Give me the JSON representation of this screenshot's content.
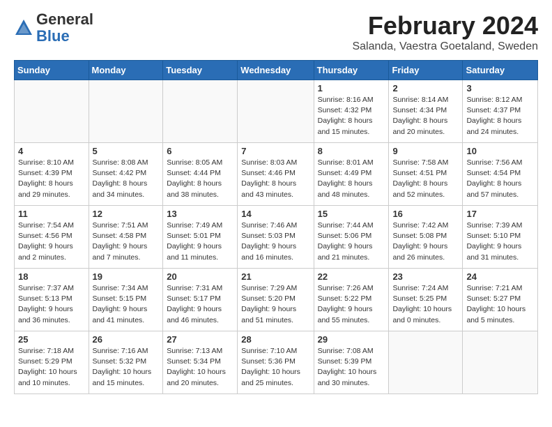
{
  "header": {
    "logo_general": "General",
    "logo_blue": "Blue",
    "month_title": "February 2024",
    "location": "Salanda, Vaestra Goetaland, Sweden"
  },
  "days_of_week": [
    "Sunday",
    "Monday",
    "Tuesday",
    "Wednesday",
    "Thursday",
    "Friday",
    "Saturday"
  ],
  "weeks": [
    [
      {
        "day": "",
        "info": ""
      },
      {
        "day": "",
        "info": ""
      },
      {
        "day": "",
        "info": ""
      },
      {
        "day": "",
        "info": ""
      },
      {
        "day": "1",
        "info": "Sunrise: 8:16 AM\nSunset: 4:32 PM\nDaylight: 8 hours\nand 15 minutes."
      },
      {
        "day": "2",
        "info": "Sunrise: 8:14 AM\nSunset: 4:34 PM\nDaylight: 8 hours\nand 20 minutes."
      },
      {
        "day": "3",
        "info": "Sunrise: 8:12 AM\nSunset: 4:37 PM\nDaylight: 8 hours\nand 24 minutes."
      }
    ],
    [
      {
        "day": "4",
        "info": "Sunrise: 8:10 AM\nSunset: 4:39 PM\nDaylight: 8 hours\nand 29 minutes."
      },
      {
        "day": "5",
        "info": "Sunrise: 8:08 AM\nSunset: 4:42 PM\nDaylight: 8 hours\nand 34 minutes."
      },
      {
        "day": "6",
        "info": "Sunrise: 8:05 AM\nSunset: 4:44 PM\nDaylight: 8 hours\nand 38 minutes."
      },
      {
        "day": "7",
        "info": "Sunrise: 8:03 AM\nSunset: 4:46 PM\nDaylight: 8 hours\nand 43 minutes."
      },
      {
        "day": "8",
        "info": "Sunrise: 8:01 AM\nSunset: 4:49 PM\nDaylight: 8 hours\nand 48 minutes."
      },
      {
        "day": "9",
        "info": "Sunrise: 7:58 AM\nSunset: 4:51 PM\nDaylight: 8 hours\nand 52 minutes."
      },
      {
        "day": "10",
        "info": "Sunrise: 7:56 AM\nSunset: 4:54 PM\nDaylight: 8 hours\nand 57 minutes."
      }
    ],
    [
      {
        "day": "11",
        "info": "Sunrise: 7:54 AM\nSunset: 4:56 PM\nDaylight: 9 hours\nand 2 minutes."
      },
      {
        "day": "12",
        "info": "Sunrise: 7:51 AM\nSunset: 4:58 PM\nDaylight: 9 hours\nand 7 minutes."
      },
      {
        "day": "13",
        "info": "Sunrise: 7:49 AM\nSunset: 5:01 PM\nDaylight: 9 hours\nand 11 minutes."
      },
      {
        "day": "14",
        "info": "Sunrise: 7:46 AM\nSunset: 5:03 PM\nDaylight: 9 hours\nand 16 minutes."
      },
      {
        "day": "15",
        "info": "Sunrise: 7:44 AM\nSunset: 5:06 PM\nDaylight: 9 hours\nand 21 minutes."
      },
      {
        "day": "16",
        "info": "Sunrise: 7:42 AM\nSunset: 5:08 PM\nDaylight: 9 hours\nand 26 minutes."
      },
      {
        "day": "17",
        "info": "Sunrise: 7:39 AM\nSunset: 5:10 PM\nDaylight: 9 hours\nand 31 minutes."
      }
    ],
    [
      {
        "day": "18",
        "info": "Sunrise: 7:37 AM\nSunset: 5:13 PM\nDaylight: 9 hours\nand 36 minutes."
      },
      {
        "day": "19",
        "info": "Sunrise: 7:34 AM\nSunset: 5:15 PM\nDaylight: 9 hours\nand 41 minutes."
      },
      {
        "day": "20",
        "info": "Sunrise: 7:31 AM\nSunset: 5:17 PM\nDaylight: 9 hours\nand 46 minutes."
      },
      {
        "day": "21",
        "info": "Sunrise: 7:29 AM\nSunset: 5:20 PM\nDaylight: 9 hours\nand 51 minutes."
      },
      {
        "day": "22",
        "info": "Sunrise: 7:26 AM\nSunset: 5:22 PM\nDaylight: 9 hours\nand 55 minutes."
      },
      {
        "day": "23",
        "info": "Sunrise: 7:24 AM\nSunset: 5:25 PM\nDaylight: 10 hours\nand 0 minutes."
      },
      {
        "day": "24",
        "info": "Sunrise: 7:21 AM\nSunset: 5:27 PM\nDaylight: 10 hours\nand 5 minutes."
      }
    ],
    [
      {
        "day": "25",
        "info": "Sunrise: 7:18 AM\nSunset: 5:29 PM\nDaylight: 10 hours\nand 10 minutes."
      },
      {
        "day": "26",
        "info": "Sunrise: 7:16 AM\nSunset: 5:32 PM\nDaylight: 10 hours\nand 15 minutes."
      },
      {
        "day": "27",
        "info": "Sunrise: 7:13 AM\nSunset: 5:34 PM\nDaylight: 10 hours\nand 20 minutes."
      },
      {
        "day": "28",
        "info": "Sunrise: 7:10 AM\nSunset: 5:36 PM\nDaylight: 10 hours\nand 25 minutes."
      },
      {
        "day": "29",
        "info": "Sunrise: 7:08 AM\nSunset: 5:39 PM\nDaylight: 10 hours\nand 30 minutes."
      },
      {
        "day": "",
        "info": ""
      },
      {
        "day": "",
        "info": ""
      }
    ]
  ]
}
